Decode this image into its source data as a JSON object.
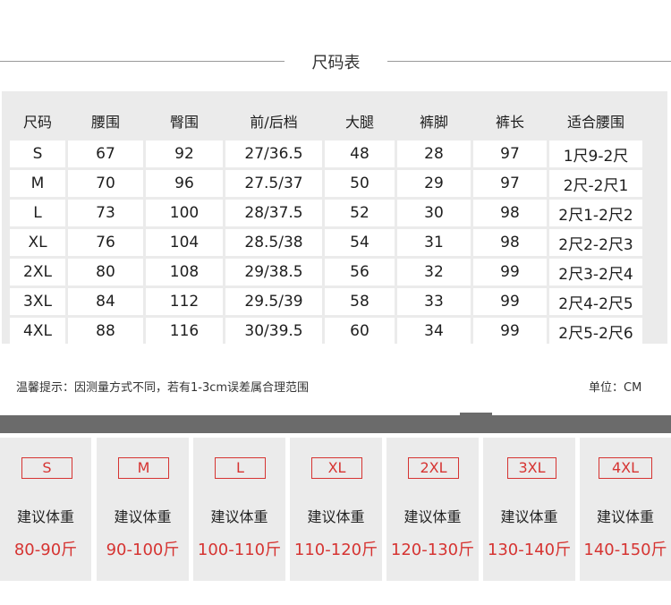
{
  "title": "尺码表",
  "table": {
    "headers": [
      "尺码",
      "腰围",
      "臀围",
      "前/后档",
      "大腿",
      "裤脚",
      "裤长",
      "适合腰围"
    ],
    "rows": [
      [
        "S",
        "67",
        "92",
        "27/36.5",
        "48",
        "28",
        "97",
        "1尺9-2尺"
      ],
      [
        "M",
        "70",
        "96",
        "27.5/37",
        "50",
        "29",
        "97",
        "2尺-2尺1"
      ],
      [
        "L",
        "73",
        "100",
        "28/37.5",
        "52",
        "30",
        "98",
        "2尺1-2尺2"
      ],
      [
        "XL",
        "76",
        "104",
        "28.5/38",
        "54",
        "31",
        "98",
        "2尺2-2尺3"
      ],
      [
        "2XL",
        "80",
        "108",
        "29/38.5",
        "56",
        "32",
        "99",
        "2尺3-2尺4"
      ],
      [
        "3XL",
        "84",
        "112",
        "29.5/39",
        "58",
        "33",
        "99",
        "2尺4-2尺5"
      ],
      [
        "4XL",
        "88",
        "116",
        "30/39.5",
        "60",
        "34",
        "99",
        "2尺5-2尺6"
      ]
    ]
  },
  "tip": "温馨提示：因测量方式不同，若有1-3cm误差属合理范围",
  "unit": "单位：CM",
  "weights": [
    {
      "size": "S",
      "label": "建议体重",
      "range": "80-90斤"
    },
    {
      "size": "M",
      "label": "建议体重",
      "range": "90-100斤"
    },
    {
      "size": "L",
      "label": "建议体重",
      "range": "100-110斤"
    },
    {
      "size": "XL",
      "label": "建议体重",
      "range": "110-120斤"
    },
    {
      "size": "2XL",
      "label": "建议体重",
      "range": "120-130斤"
    },
    {
      "size": "3XL",
      "label": "建议体重",
      "range": "130-140斤"
    },
    {
      "size": "4XL",
      "label": "建议体重",
      "range": "140-150斤"
    }
  ],
  "colors": {
    "accent": "#d63432",
    "bar": "#6b6b6b",
    "panel": "#ebebeb"
  }
}
